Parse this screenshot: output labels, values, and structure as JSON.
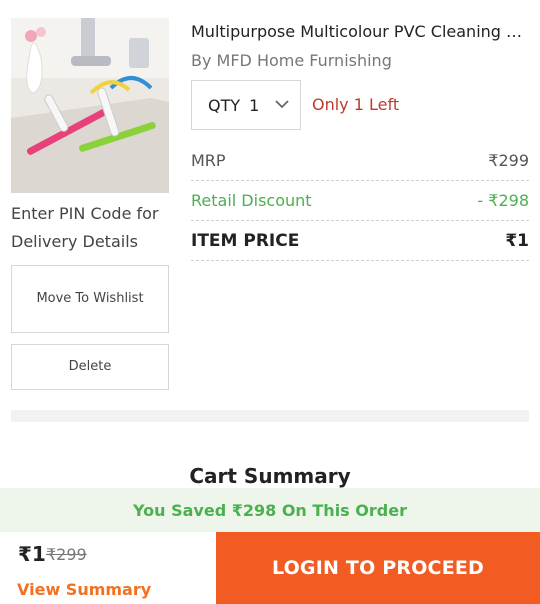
{
  "product": {
    "title": "Multipurpose Multicolour PVC Cleaning Wi...",
    "brand": "By MFD Home Furnishing",
    "qty_label": "QTY",
    "qty_value": "1",
    "stock_text": "Only 1 Left",
    "image_icon": "wiper-product-image"
  },
  "pricing": {
    "mrp_label": "MRP",
    "mrp_value": "₹299",
    "discount_label": "Retail Discount",
    "discount_value": "- ₹298",
    "item_price_label": "ITEM PRICE",
    "item_price_value": "₹1"
  },
  "actions": {
    "pin_text": "Enter PIN Code for Delivery Details",
    "wishlist_label": "Move To Wishlist",
    "delete_label": "Delete"
  },
  "summary": {
    "heading": "Cart Summary",
    "saved_text": "You Saved ₹298 On This Order"
  },
  "bottom_bar": {
    "total": "₹1",
    "total_mrp": "₹299",
    "view_summary_label": "View Summary",
    "login_label": "LOGIN TO PROCEED"
  },
  "colors": {
    "accent": "#f25b22",
    "discount_green": "#4caf50",
    "stock_red": "#c0392b"
  }
}
